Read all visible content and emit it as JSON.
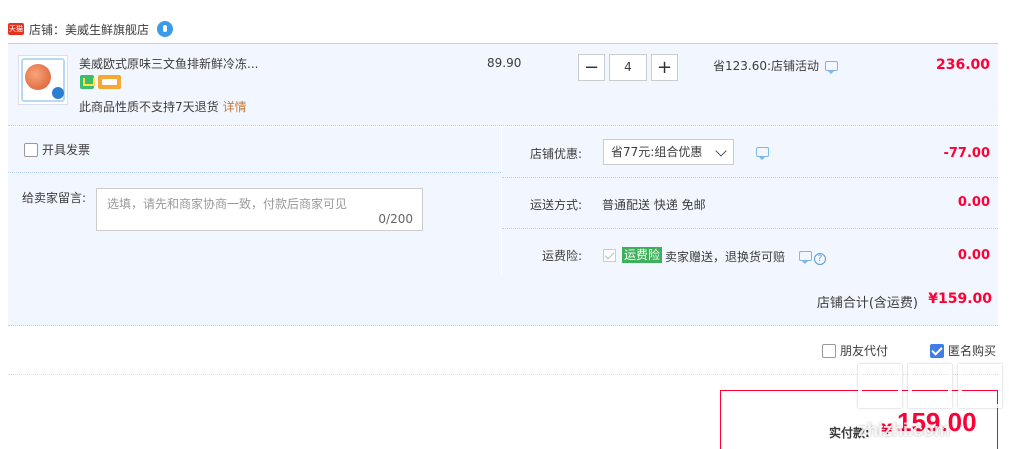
{
  "shop": {
    "logo_text": "天猫",
    "name_label": "店铺：美威生鲜旗舰店"
  },
  "item": {
    "title": "美威欧式原味三文鱼排新鲜冷冻...",
    "no_return_text": "此商品性质不支持7天退货",
    "detail_link": "详情",
    "unit_price": "89.90",
    "quantity": "4",
    "minus_label": "−",
    "plus_label": "+",
    "promo_text": "省123.60:店铺活动",
    "subtotal": "236.00"
  },
  "invoice": {
    "label": "开具发票"
  },
  "message": {
    "label": "给卖家留言:",
    "placeholder": "选填，请先和商家协商一致，付款后商家可见",
    "count": "0/200"
  },
  "discount": {
    "label": "店铺优惠:",
    "selected": "省77元:组合优惠",
    "amount": "-77.00"
  },
  "shipping": {
    "label": "运送方式:",
    "method": "普通配送 快递 免邮",
    "fee": "0.00"
  },
  "insurance": {
    "label": "运费险:",
    "badge": "运费险",
    "text": "卖家赠送，退换货可赔",
    "fee": "0.00"
  },
  "shop_total": {
    "label": "店铺合计(含运费)",
    "value": "¥159.00"
  },
  "options": {
    "friend_pay": "朋友代付",
    "anonymous": "匿名购买"
  },
  "payment": {
    "label": "实付款:",
    "currency": "¥",
    "value": "159.00"
  },
  "watermark": {
    "url": "zhizhi.com"
  },
  "colors": {
    "accent_red": "#ff0036",
    "panel_bg": "#f2f7ff",
    "border_blue": "#b2d1ff"
  }
}
